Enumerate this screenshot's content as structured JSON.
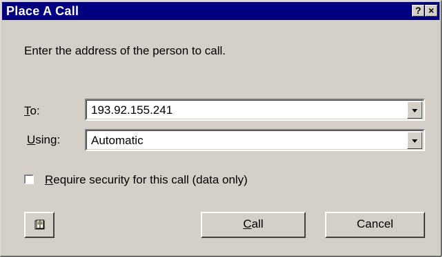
{
  "window": {
    "title": "Place A Call",
    "help_glyph": "?",
    "close_glyph": "×"
  },
  "instruction": "Enter the address of the person to call.",
  "fields": {
    "to": {
      "label_prefix": "",
      "label_accel": "T",
      "label_rest": "o:",
      "value": "193.92.155.241"
    },
    "using": {
      "label_accel": "U",
      "label_rest": "sing:",
      "value": "Automatic"
    }
  },
  "security": {
    "accel": "R",
    "label_rest": "equire security for this call (data only)",
    "checked": false
  },
  "buttons": {
    "address_book_icon": "address-book-icon",
    "call_accel": "C",
    "call_rest": "all",
    "cancel_label": "Cancel"
  }
}
